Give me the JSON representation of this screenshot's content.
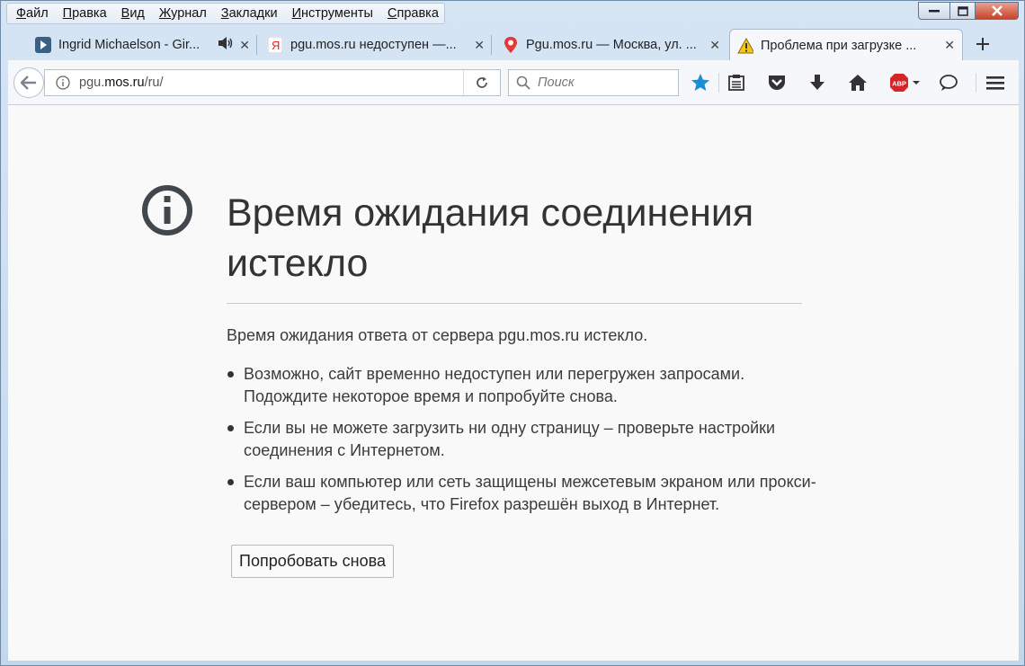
{
  "menu": [
    "Файл",
    "Правка",
    "Вид",
    "Журнал",
    "Закладки",
    "Инструменты",
    "Справка"
  ],
  "menu_mnemonic": [
    "Ф",
    "П",
    "В",
    "Ж",
    "З",
    "И",
    "С"
  ],
  "tabs": [
    {
      "label": "Ingrid Michaelson - Gir...",
      "icon": "video-play-icon",
      "audio": true
    },
    {
      "label": "pgu.mos.ru недоступен —...",
      "icon": "yandex-icon"
    },
    {
      "label": "Pgu.mos.ru — Москва, ул. ...",
      "icon": "map-pin-icon"
    },
    {
      "label": "Проблема при загрузке ...",
      "icon": "warning-icon",
      "active": true
    }
  ],
  "url": {
    "prefix": "pgu.",
    "domain": "mos.ru",
    "path": "/ru/"
  },
  "search": {
    "placeholder": "Поиск"
  },
  "toolbar_icons": [
    "bookmark-star-icon",
    "reader-list-icon",
    "pocket-icon",
    "download-icon",
    "home-icon",
    "adblock-plus-icon",
    "chat-icon",
    "hamburger-menu-icon"
  ],
  "error": {
    "title": "Время ожидания соединения истекло",
    "description": "Время ожидания ответа от сервера pgu.mos.ru истекло.",
    "bullets": [
      "Возможно, сайт временно недоступен или перегружен запросами. Подождите некоторое время и попробуйте снова.",
      "Если вы не можете загрузить ни одну страницу – проверьте настройки соединения с Интернетом.",
      "Если ваш компьютер или сеть защищены межсетевым экраном или прокси-сервером – убедитесь, что Firefox разрешён выход в Интернет."
    ],
    "retry_label": "Попробовать снова"
  },
  "colors": {
    "accent_star": "#1a8fd6",
    "abp_red": "#d32626",
    "text": "#3b3b3b"
  }
}
